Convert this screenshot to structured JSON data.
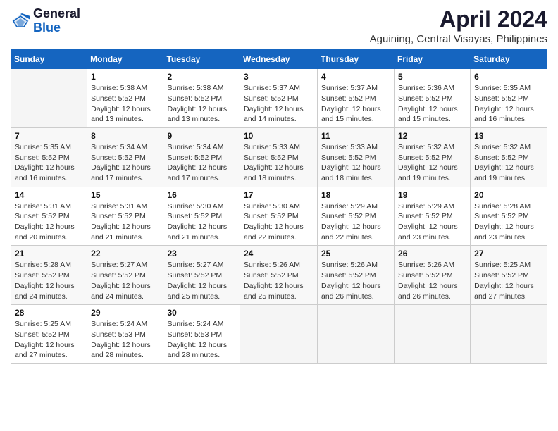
{
  "header": {
    "logo": {
      "general": "General",
      "blue": "Blue"
    },
    "title": "April 2024",
    "location": "Aguining, Central Visayas, Philippines"
  },
  "calendar": {
    "days_of_week": [
      "Sunday",
      "Monday",
      "Tuesday",
      "Wednesday",
      "Thursday",
      "Friday",
      "Saturday"
    ],
    "weeks": [
      [
        {
          "day": "",
          "info": ""
        },
        {
          "day": "1",
          "info": "Sunrise: 5:38 AM\nSunset: 5:52 PM\nDaylight: 12 hours\nand 13 minutes."
        },
        {
          "day": "2",
          "info": "Sunrise: 5:38 AM\nSunset: 5:52 PM\nDaylight: 12 hours\nand 13 minutes."
        },
        {
          "day": "3",
          "info": "Sunrise: 5:37 AM\nSunset: 5:52 PM\nDaylight: 12 hours\nand 14 minutes."
        },
        {
          "day": "4",
          "info": "Sunrise: 5:37 AM\nSunset: 5:52 PM\nDaylight: 12 hours\nand 15 minutes."
        },
        {
          "day": "5",
          "info": "Sunrise: 5:36 AM\nSunset: 5:52 PM\nDaylight: 12 hours\nand 15 minutes."
        },
        {
          "day": "6",
          "info": "Sunrise: 5:35 AM\nSunset: 5:52 PM\nDaylight: 12 hours\nand 16 minutes."
        }
      ],
      [
        {
          "day": "7",
          "info": "Sunrise: 5:35 AM\nSunset: 5:52 PM\nDaylight: 12 hours\nand 16 minutes."
        },
        {
          "day": "8",
          "info": "Sunrise: 5:34 AM\nSunset: 5:52 PM\nDaylight: 12 hours\nand 17 minutes."
        },
        {
          "day": "9",
          "info": "Sunrise: 5:34 AM\nSunset: 5:52 PM\nDaylight: 12 hours\nand 17 minutes."
        },
        {
          "day": "10",
          "info": "Sunrise: 5:33 AM\nSunset: 5:52 PM\nDaylight: 12 hours\nand 18 minutes."
        },
        {
          "day": "11",
          "info": "Sunrise: 5:33 AM\nSunset: 5:52 PM\nDaylight: 12 hours\nand 18 minutes."
        },
        {
          "day": "12",
          "info": "Sunrise: 5:32 AM\nSunset: 5:52 PM\nDaylight: 12 hours\nand 19 minutes."
        },
        {
          "day": "13",
          "info": "Sunrise: 5:32 AM\nSunset: 5:52 PM\nDaylight: 12 hours\nand 19 minutes."
        }
      ],
      [
        {
          "day": "14",
          "info": "Sunrise: 5:31 AM\nSunset: 5:52 PM\nDaylight: 12 hours\nand 20 minutes."
        },
        {
          "day": "15",
          "info": "Sunrise: 5:31 AM\nSunset: 5:52 PM\nDaylight: 12 hours\nand 21 minutes."
        },
        {
          "day": "16",
          "info": "Sunrise: 5:30 AM\nSunset: 5:52 PM\nDaylight: 12 hours\nand 21 minutes."
        },
        {
          "day": "17",
          "info": "Sunrise: 5:30 AM\nSunset: 5:52 PM\nDaylight: 12 hours\nand 22 minutes."
        },
        {
          "day": "18",
          "info": "Sunrise: 5:29 AM\nSunset: 5:52 PM\nDaylight: 12 hours\nand 22 minutes."
        },
        {
          "day": "19",
          "info": "Sunrise: 5:29 AM\nSunset: 5:52 PM\nDaylight: 12 hours\nand 23 minutes."
        },
        {
          "day": "20",
          "info": "Sunrise: 5:28 AM\nSunset: 5:52 PM\nDaylight: 12 hours\nand 23 minutes."
        }
      ],
      [
        {
          "day": "21",
          "info": "Sunrise: 5:28 AM\nSunset: 5:52 PM\nDaylight: 12 hours\nand 24 minutes."
        },
        {
          "day": "22",
          "info": "Sunrise: 5:27 AM\nSunset: 5:52 PM\nDaylight: 12 hours\nand 24 minutes."
        },
        {
          "day": "23",
          "info": "Sunrise: 5:27 AM\nSunset: 5:52 PM\nDaylight: 12 hours\nand 25 minutes."
        },
        {
          "day": "24",
          "info": "Sunrise: 5:26 AM\nSunset: 5:52 PM\nDaylight: 12 hours\nand 25 minutes."
        },
        {
          "day": "25",
          "info": "Sunrise: 5:26 AM\nSunset: 5:52 PM\nDaylight: 12 hours\nand 26 minutes."
        },
        {
          "day": "26",
          "info": "Sunrise: 5:26 AM\nSunset: 5:52 PM\nDaylight: 12 hours\nand 26 minutes."
        },
        {
          "day": "27",
          "info": "Sunrise: 5:25 AM\nSunset: 5:52 PM\nDaylight: 12 hours\nand 27 minutes."
        }
      ],
      [
        {
          "day": "28",
          "info": "Sunrise: 5:25 AM\nSunset: 5:52 PM\nDaylight: 12 hours\nand 27 minutes."
        },
        {
          "day": "29",
          "info": "Sunrise: 5:24 AM\nSunset: 5:53 PM\nDaylight: 12 hours\nand 28 minutes."
        },
        {
          "day": "30",
          "info": "Sunrise: 5:24 AM\nSunset: 5:53 PM\nDaylight: 12 hours\nand 28 minutes."
        },
        {
          "day": "",
          "info": ""
        },
        {
          "day": "",
          "info": ""
        },
        {
          "day": "",
          "info": ""
        },
        {
          "day": "",
          "info": ""
        }
      ]
    ]
  }
}
